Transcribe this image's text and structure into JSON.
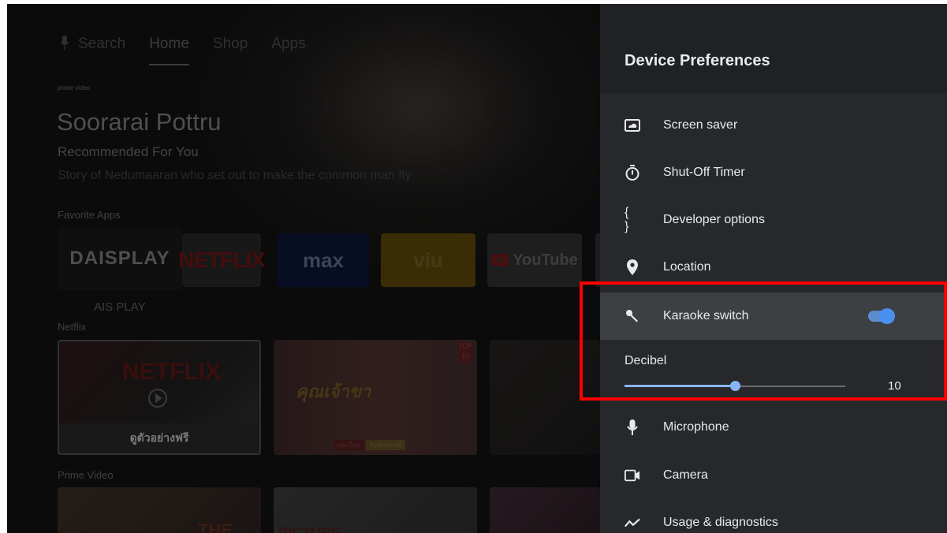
{
  "home": {
    "nav": {
      "search": "Search",
      "home": "Home",
      "shop": "Shop",
      "apps": "Apps"
    },
    "prime_logo": "prime video",
    "hero": {
      "title": "Soorarai Pottru",
      "subtitle": "Recommended For You",
      "description": "Story of Nedumaaran who set out to make the common man fly"
    },
    "favorite_apps_label": "Favorite Apps",
    "apps": {
      "ais": "DAISPLAY",
      "netflix": "NETFLIX",
      "max": "max",
      "viu": "viu",
      "youtube": "YouTube"
    },
    "ais_label": "AIS PLAY",
    "netflix_row_label": "Netflix",
    "prime_row_label": "Prime Video",
    "cards": {
      "netflix_brand": "NETFLIX",
      "netflix_caption": "ดูตัวอย่างฟรี",
      "top10": "TOP 10",
      "thai_title": "คุณเจ้าขา",
      "badge_new": "ตอนใหม่",
      "badge_watch": "รับชมตอนนี้",
      "the": "THE",
      "picture": "PICTURE"
    }
  },
  "panel": {
    "title": "Device Preferences",
    "items": [
      {
        "label": "Screen saver",
        "icon": "screen-saver-icon"
      },
      {
        "label": "Shut-Off Timer",
        "icon": "timer-icon"
      },
      {
        "label": "Developer options",
        "icon": "braces-icon",
        "glyph": "{ }"
      },
      {
        "label": "Location",
        "icon": "location-pin-icon"
      },
      {
        "label": "Karaoke switch",
        "icon": "karaoke-mic-icon",
        "toggle_on": true
      },
      {
        "label": "Microphone",
        "icon": "microphone-icon"
      },
      {
        "label": "Camera",
        "icon": "camera-icon"
      },
      {
        "label": "Usage & diagnostics",
        "icon": "diagnostics-icon"
      }
    ],
    "decibel": {
      "label": "Decibel",
      "value": "10",
      "fraction": 0.5
    }
  },
  "colors": {
    "accent": "#8ab4f8",
    "highlight": "#ff0000",
    "panel_bg": "#26282b"
  }
}
